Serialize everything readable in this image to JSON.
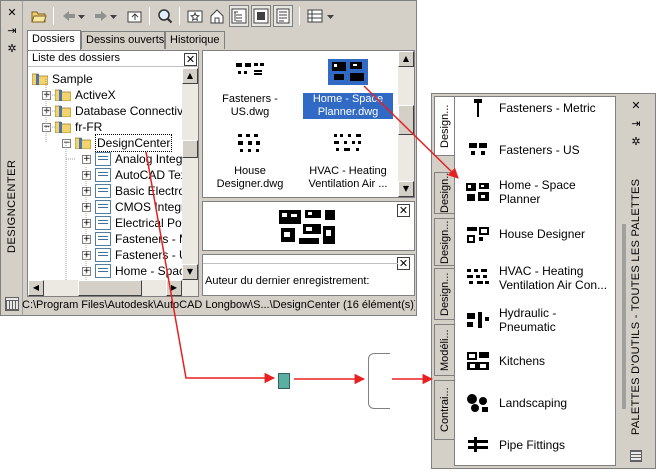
{
  "designcenter": {
    "title": "DESIGNCENTER",
    "tabs": [
      "Dossiers",
      "Dessins ouverts",
      "Historique"
    ],
    "tree_header": "Liste des dossiers",
    "tree": [
      {
        "label": "Sample",
        "kind": "folder",
        "pm": "−"
      },
      {
        "label": "ActiveX",
        "kind": "folder",
        "pm": "+"
      },
      {
        "label": "Database Connectivity",
        "kind": "folder",
        "pm": "+"
      },
      {
        "label": "fr-FR",
        "kind": "folder",
        "pm": "−"
      },
      {
        "label": "DesignCenter",
        "kind": "folder",
        "pm": "−"
      },
      {
        "label": "Analog Integrat",
        "kind": "file",
        "pm": "+"
      },
      {
        "label": "AutoCAD Texts",
        "kind": "file",
        "pm": "+"
      },
      {
        "label": "Basic Electroni",
        "kind": "file",
        "pm": "+"
      },
      {
        "label": "CMOS Integrat",
        "kind": "file",
        "pm": "+"
      },
      {
        "label": "Electrical Powe",
        "kind": "file",
        "pm": "+"
      },
      {
        "label": "Fasteners - Met",
        "kind": "file",
        "pm": "+"
      },
      {
        "label": "Fasteners - US",
        "kind": "file",
        "pm": "+"
      },
      {
        "label": "Home - Space",
        "kind": "file",
        "pm": "+"
      }
    ],
    "content_items": [
      {
        "caption": "Fasteners -\nUS.dwg",
        "selected": false
      },
      {
        "caption": "Home - Space\nPlanner.dwg",
        "selected": true
      },
      {
        "caption": "House\nDesigner.dwg",
        "selected": false
      },
      {
        "caption": "HVAC - Heating\nVentilation Air ...",
        "selected": false
      }
    ],
    "description_label": "Auteur du dernier enregistrement:",
    "status_path": "C:\\Program Files\\Autodesk\\AutoCAD Longbow\\S...\\DesignCenter (16 élément(s))"
  },
  "palettes": {
    "title": "PALETTES D'OUTILS - TOUTES LES PALETTES",
    "tabs": [
      "Design...",
      "Design...",
      "Design...",
      "Design...",
      "Modéli...",
      "Contrai..."
    ],
    "items": [
      "Fasteners - Metric",
      "Fasteners - US",
      "Home - Space Planner",
      "House Designer",
      "HVAC - Heating Ventilation Air Con...",
      "Hydraulic - Pneumatic",
      "Kitchens",
      "Landscaping",
      "Pipe Fittings"
    ]
  },
  "colors": {
    "arrow": "#e82020",
    "selection": "#316ac5",
    "chrome": "#d4d0c8"
  },
  "icons": [
    "open-icon",
    "back-icon",
    "forward-icon",
    "up-icon",
    "search-icon",
    "favorites-icon",
    "home-icon",
    "tree-toggle-icon",
    "preview-icon",
    "description-icon",
    "views-icon",
    "close-icon",
    "autohide-icon",
    "properties-icon"
  ]
}
